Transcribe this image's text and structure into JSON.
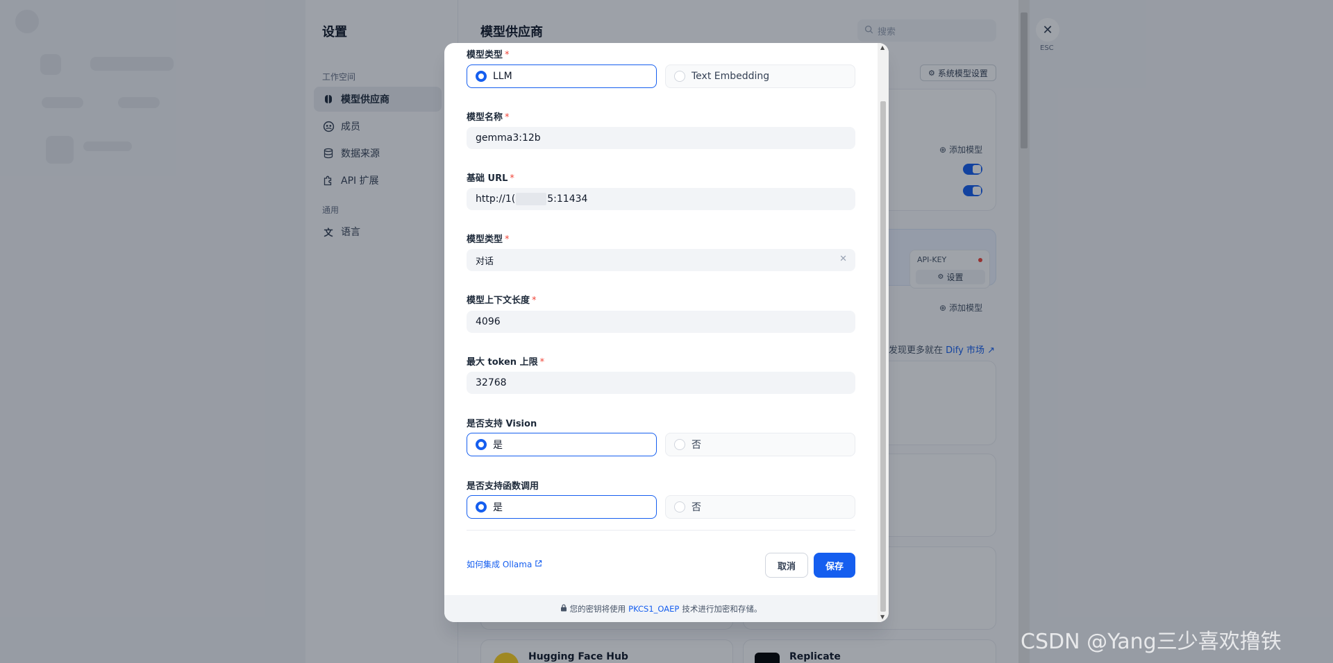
{
  "settings": {
    "title": "设置",
    "workspace_group": "工作空间",
    "general_group": "通用",
    "nav": [
      {
        "label": "模型供应商"
      },
      {
        "label": "成员"
      },
      {
        "label": "数据来源"
      },
      {
        "label": "API 扩展"
      },
      {
        "label": "语言"
      }
    ]
  },
  "main": {
    "title": "模型供应商",
    "search_placeholder": "搜索",
    "system_model_settings": "系统模型设置",
    "add_model": "添加模型",
    "api_key_label": "API-KEY",
    "setup": "设置",
    "discover_more": "发现更多就在",
    "market_link": "Dify 市场",
    "providers": [
      "Hugging Face Hub",
      "Replicate"
    ]
  },
  "close": {
    "esc": "ESC"
  },
  "modal": {
    "model_type_label": "模型类型",
    "model_type_options": [
      "LLM",
      "Text Embedding"
    ],
    "model_name_label": "模型名称",
    "model_name_value": "gemma3:12b",
    "base_url_label": "基础 URL",
    "base_url_prefix": "http://1(",
    "base_url_suffix": "5:11434",
    "completion_type_label": "模型类型",
    "completion_type_value": "对话",
    "context_size_label": "模型上下文长度",
    "context_size_value": "4096",
    "max_tokens_label": "最大 token 上限",
    "max_tokens_value": "32768",
    "vision_label": "是否支持 Vision",
    "function_call_label": "是否支持函数调用",
    "yes": "是",
    "no": "否",
    "required_mark": "*",
    "help_link": "如何集成 Ollama",
    "cancel": "取消",
    "save": "保存",
    "footer_prefix": "您的密钥将使用",
    "footer_link": "PKCS1_OAEP",
    "footer_suffix": "技术进行加密和存储。"
  },
  "watermark": "CSDN @Yang三少喜欢撸铁"
}
